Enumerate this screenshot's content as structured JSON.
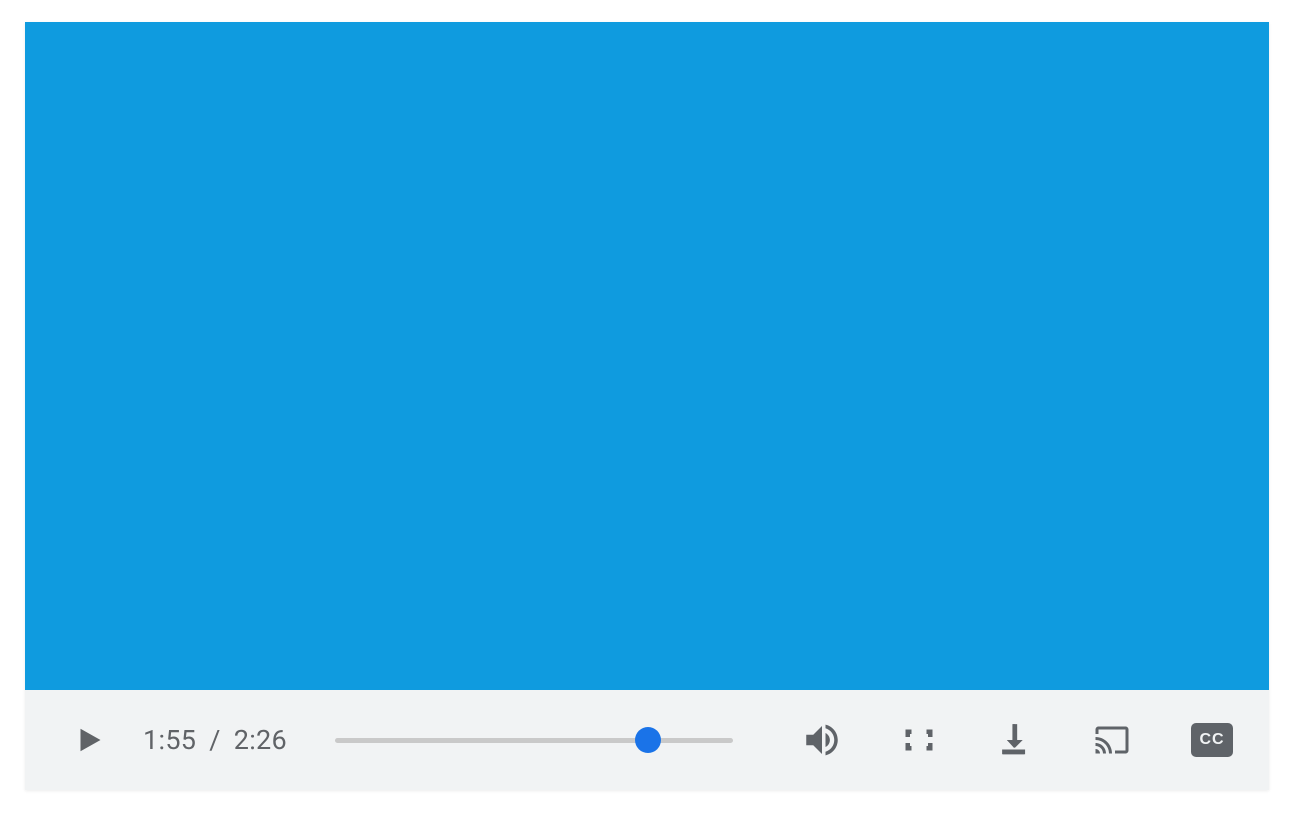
{
  "player": {
    "video_surface_color": "#0f9bdf",
    "current_time": "1:55",
    "duration": "2:26",
    "time_separator": "/",
    "progress_percent": 78.7,
    "cc_label": "CC",
    "icons": {
      "play": "play-icon",
      "volume": "volume-icon",
      "fullscreen": "fullscreen-icon",
      "download": "download-icon",
      "cast": "cast-icon",
      "captions": "captions-icon"
    }
  }
}
